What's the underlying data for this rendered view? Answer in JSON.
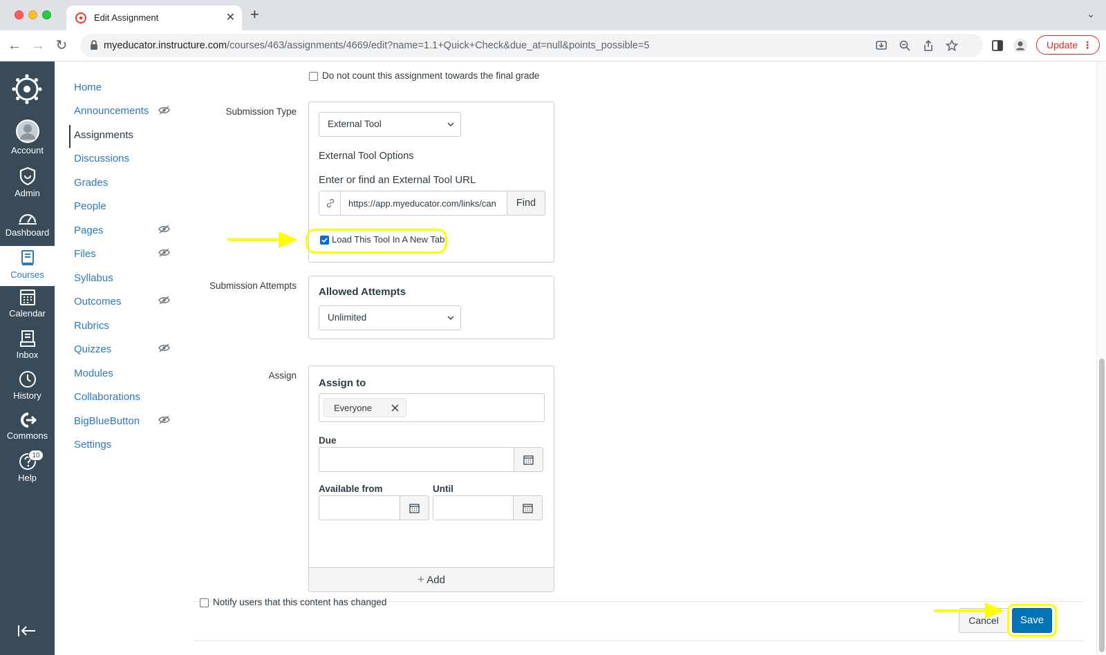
{
  "browser": {
    "tab_title": "Edit Assignment",
    "url_host": "myeducator.instructure.com",
    "url_path": "/courses/463/assignments/4669/edit?name=1.1+Quick+Check&due_at=null&points_possible=5",
    "update_label": "Update"
  },
  "global_nav": {
    "items": [
      {
        "label": "Account"
      },
      {
        "label": "Admin"
      },
      {
        "label": "Dashboard"
      },
      {
        "label": "Courses"
      },
      {
        "label": "Calendar"
      },
      {
        "label": "Inbox"
      },
      {
        "label": "History"
      },
      {
        "label": "Commons"
      },
      {
        "label": "Help",
        "badge": "10"
      }
    ],
    "active": "Courses"
  },
  "course_nav": {
    "items": [
      {
        "label": "Home",
        "hidden": false
      },
      {
        "label": "Announcements",
        "hidden": true
      },
      {
        "label": "Assignments",
        "hidden": false
      },
      {
        "label": "Discussions",
        "hidden": false
      },
      {
        "label": "Grades",
        "hidden": false
      },
      {
        "label": "People",
        "hidden": false
      },
      {
        "label": "Pages",
        "hidden": true
      },
      {
        "label": "Files",
        "hidden": true
      },
      {
        "label": "Syllabus",
        "hidden": false
      },
      {
        "label": "Outcomes",
        "hidden": true
      },
      {
        "label": "Rubrics",
        "hidden": false
      },
      {
        "label": "Quizzes",
        "hidden": true
      },
      {
        "label": "Modules",
        "hidden": false
      },
      {
        "label": "Collaborations",
        "hidden": false
      },
      {
        "label": "BigBlueButton",
        "hidden": true
      },
      {
        "label": "Settings",
        "hidden": false
      }
    ],
    "active": "Assignments"
  },
  "form": {
    "final_grade_checkbox_label": "Do not count this assignment towards the final grade",
    "final_grade_checked": false,
    "submission_type": {
      "label": "Submission Type",
      "value": "External Tool",
      "options_heading": "External Tool Options",
      "url_heading": "Enter or find an External Tool URL",
      "url_value": "https://app.myeducator.com/links/can",
      "find_label": "Find",
      "new_tab_label": "Load This Tool In A New Tab",
      "new_tab_checked": true
    },
    "submission_attempts": {
      "label": "Submission Attempts",
      "heading": "Allowed Attempts",
      "value": "Unlimited"
    },
    "assign": {
      "label": "Assign",
      "heading": "Assign to",
      "assignee_tag": "Everyone",
      "due_label": "Due",
      "due_value": "",
      "available_from_label": "Available from",
      "available_from_value": "",
      "until_label": "Until",
      "until_value": "",
      "add_label": "Add"
    },
    "notify_label": "Notify users that this content has changed",
    "notify_checked": false,
    "cancel_label": "Cancel",
    "save_label": "Save"
  },
  "colors": {
    "nav_bg": "#394b58",
    "link": "#2b7abc",
    "save_button": "#0374b5",
    "highlight": "#fbff00",
    "checkbox_checked": "#0b6bda"
  }
}
